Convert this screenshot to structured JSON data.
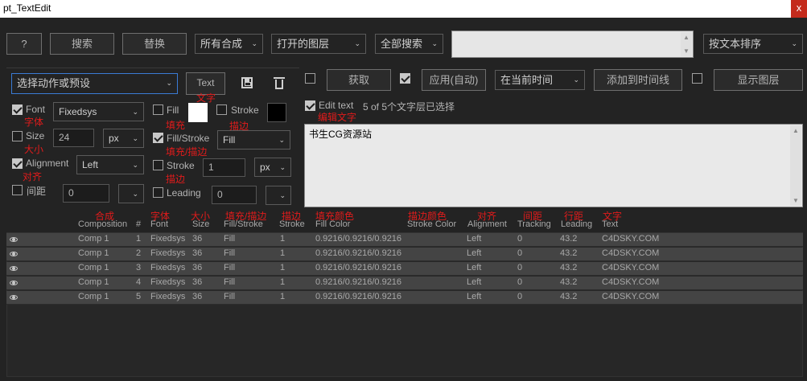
{
  "window": {
    "title": "pt_TextEdit",
    "close": "x"
  },
  "toolbar": {
    "help": "?",
    "search": "搜索",
    "replace": "替换",
    "comp_scope": "所有合成",
    "layer_scope": "打开的图层",
    "search_scope": "全部搜索",
    "search_value": "",
    "sort": "按文本排序"
  },
  "preset": {
    "value": "选择动作或预设",
    "text_btn": "Text",
    "text_cn": "文字"
  },
  "props": {
    "font": {
      "label": "Font",
      "cn": "字体",
      "value": "Fixedsys",
      "checked": true
    },
    "size": {
      "label": "Size",
      "cn": "大小",
      "value": "24",
      "unit": "px",
      "checked": false
    },
    "alignment": {
      "label": "Alignment",
      "cn": "对齐",
      "value": "Left",
      "checked": true
    },
    "spacing": {
      "label": "间距",
      "value": "0",
      "checked": false
    },
    "fill": {
      "label": "Fill",
      "cn": "填充",
      "color": "#ffffff",
      "checked": false
    },
    "stroke_color": {
      "label": "Stroke",
      "cn": "描边",
      "color": "#000000",
      "checked": false
    },
    "fill_stroke": {
      "label": "Fill/Stroke",
      "cn": "填充/描边",
      "value": "Fill",
      "checked": true
    },
    "stroke": {
      "label": "Stroke",
      "cn": "描边",
      "value": "1",
      "unit": "px",
      "checked": false
    },
    "leading": {
      "label": "Leading",
      "value": "0",
      "checked": false
    }
  },
  "actions": {
    "get": "获取",
    "apply": "应用(自动)",
    "time": "在当前时间",
    "add_timeline": "添加到时间线",
    "show_layers": "显示图层"
  },
  "edit": {
    "label": "Edit text",
    "cn": "编辑文字",
    "status": "5 of 5个文字层已选择",
    "content": "书生CG资源站"
  },
  "table": {
    "headers_cn": [
      "合成",
      "字体",
      "大小",
      "填充/描边",
      "描边",
      "填充颜色",
      "描边颜色",
      "对齐",
      "间距",
      "行距",
      "文字"
    ],
    "headers": [
      "Composition",
      "#",
      "Font",
      "Size",
      "Fill/Stroke",
      "Stroke",
      "Fill Color",
      "Stroke Color",
      "Alignment",
      "Tracking",
      "Leading",
      "Text"
    ],
    "rows": [
      [
        "Comp 1",
        "1",
        "Fixedsys",
        "36",
        "Fill",
        "1",
        "0.9216/0.9216/0.9216",
        "",
        "Left",
        "0",
        "43.2",
        "C4DSKY.COM"
      ],
      [
        "Comp 1",
        "2",
        "Fixedsys",
        "36",
        "Fill",
        "1",
        "0.9216/0.9216/0.9216",
        "",
        "Left",
        "0",
        "43.2",
        "C4DSKY.COM"
      ],
      [
        "Comp 1",
        "3",
        "Fixedsys",
        "36",
        "Fill",
        "1",
        "0.9216/0.9216/0.9216",
        "",
        "Left",
        "0",
        "43.2",
        "C4DSKY.COM"
      ],
      [
        "Comp 1",
        "4",
        "Fixedsys",
        "36",
        "Fill",
        "1",
        "0.9216/0.9216/0.9216",
        "",
        "Left",
        "0",
        "43.2",
        "C4DSKY.COM"
      ],
      [
        "Comp 1",
        "5",
        "Fixedsys",
        "36",
        "Fill",
        "1",
        "0.9216/0.9216/0.9216",
        "",
        "Left",
        "0",
        "43.2",
        "C4DSKY.COM"
      ]
    ]
  },
  "colors": {
    "annotation": "#e01b1b",
    "accent_border": "#3a7bd5"
  }
}
